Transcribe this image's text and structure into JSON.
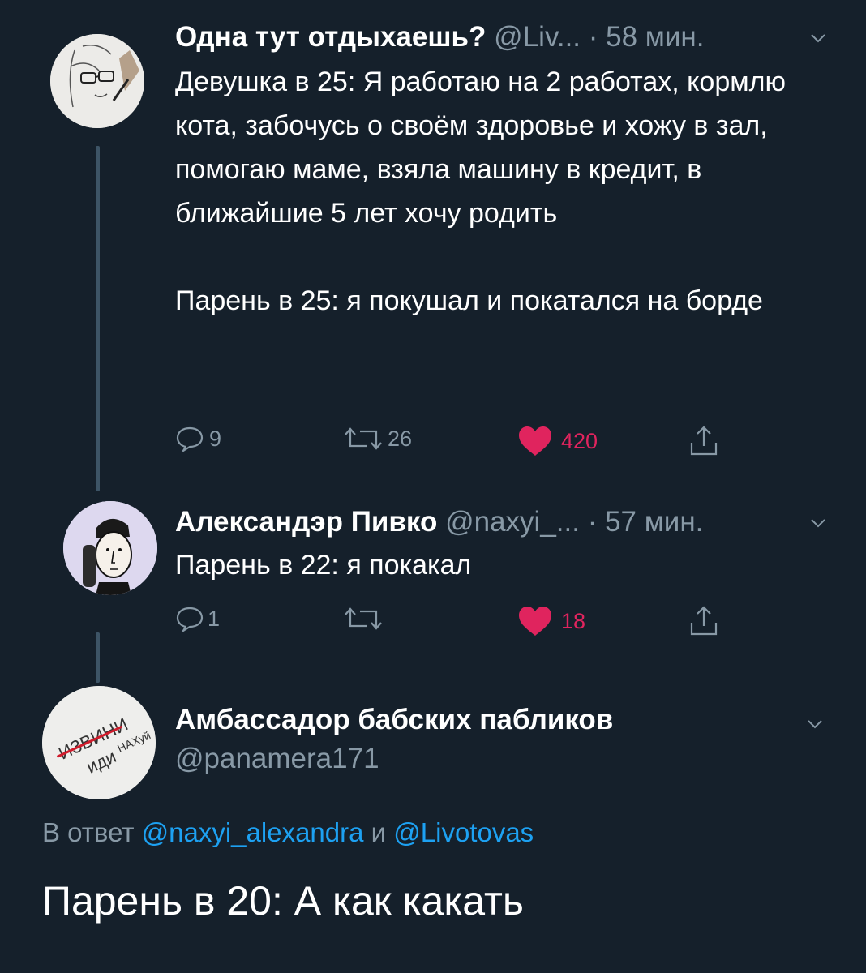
{
  "tweets": [
    {
      "name": "Одна тут отдыхаешь?",
      "handle": "@Liv...",
      "time": "· 58 мин.",
      "text": "Девушка в 25: Я работаю на 2 работах, кормлю кота, забочусь о своём здоровье и хожу в зал, помогаю маме, взяла машину в кредит, в ближайшие 5 лет хочу родить\n\nПарень в 25: я покушал и покатался на борде",
      "replies": "9",
      "retweets": "26",
      "likes": "420",
      "liked": true
    },
    {
      "name": "Александэр Пивко",
      "handle": "@naxyi_...",
      "time": "· 57 мин.",
      "text": "Парень в 22: я покакал",
      "replies": "1",
      "retweets": "",
      "likes": "18",
      "liked": true
    }
  ],
  "main_tweet": {
    "name": "Амбассадор бабских пабликов",
    "handle": "@panamera171",
    "reply_prefix": "В ответ",
    "reply_user1": "@naxyi_alexandra",
    "reply_and": "и",
    "reply_user2": "@Livotovas",
    "text": "Парень в 20: А как какать",
    "avatar_text_crossed": "ИЗВИНИ",
    "avatar_text_1": "иди",
    "avatar_text_2": "НАХуй"
  },
  "colors": {
    "background": "#15202b",
    "secondary_text": "#8899a6",
    "link": "#1da1f2",
    "like": "#e0245e",
    "thread_line": "#3d5466"
  }
}
